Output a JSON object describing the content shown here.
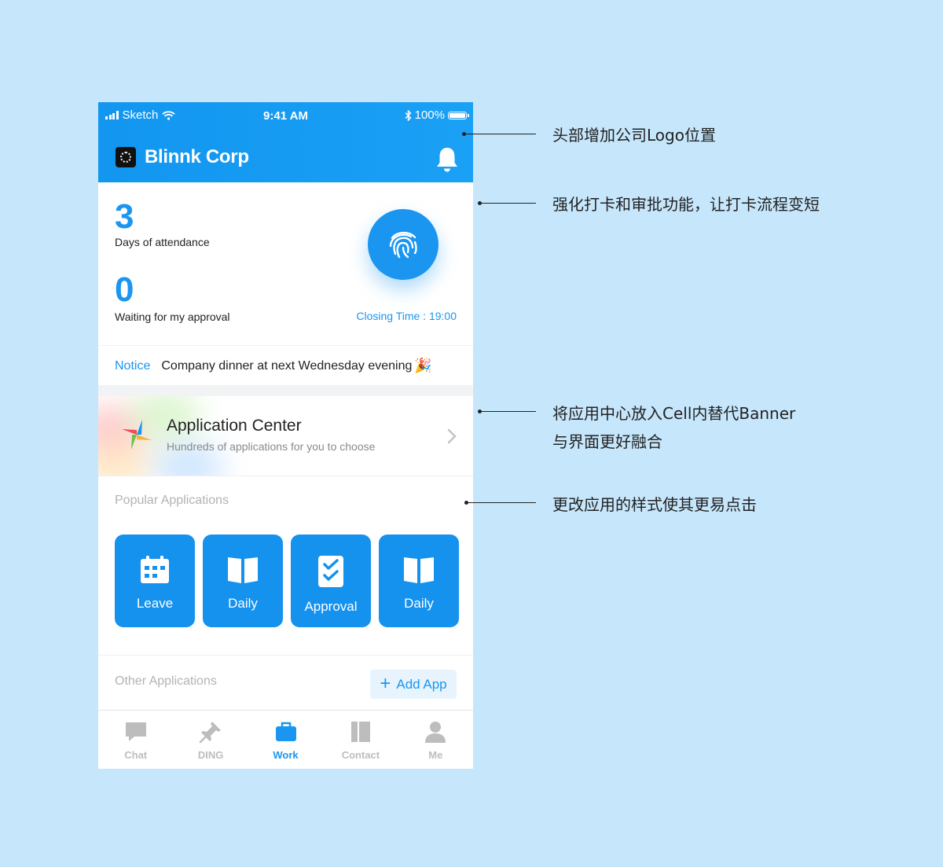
{
  "status_bar": {
    "carrier": "Sketch",
    "time": "9:41 AM",
    "battery": "100%"
  },
  "header": {
    "company": "Blinnk Corp",
    "logo_icon": "company-logo",
    "bell_icon": "bell-icon"
  },
  "attendance": {
    "days_count": "3",
    "days_label": "Days of attendance",
    "approval_count": "0",
    "approval_label": "Waiting for my approval",
    "fingerprint_icon": "fingerprint-icon",
    "closing_time": "Closing Time : 19:00"
  },
  "notice": {
    "tag": "Notice",
    "message": "Company dinner at next Wednesday evening",
    "emoji": "🎉"
  },
  "app_center": {
    "title": "Application Center",
    "subtitle": "Hundreds of applications for you to choose"
  },
  "popular": {
    "title": "Popular Applications",
    "apps": [
      {
        "label": "Leave",
        "icon": "calendar-icon"
      },
      {
        "label": "Daily",
        "icon": "book-icon"
      },
      {
        "label": "Approval",
        "icon": "checklist-icon"
      },
      {
        "label": "Daily",
        "icon": "book-icon"
      }
    ]
  },
  "other": {
    "title": "Other Applications",
    "add_label": "Add App"
  },
  "tabs": [
    {
      "label": "Chat",
      "icon": "chat-icon",
      "active": false
    },
    {
      "label": "DING",
      "icon": "pin-icon",
      "active": false
    },
    {
      "label": "Work",
      "icon": "briefcase-icon",
      "active": true
    },
    {
      "label": "Contact",
      "icon": "contact-book-icon",
      "active": false
    },
    {
      "label": "Me",
      "icon": "person-icon",
      "active": false
    }
  ],
  "annotations": [
    "头部增加公司Logo位置",
    "强化打卡和审批功能，让打卡流程变短",
    "将应用中心放入Cell内替代Banner",
    "与界面更好融合",
    "更改应用的样式使其更易点击"
  ],
  "colors": {
    "background": "#c6e6fb",
    "primary": "#1a96f0",
    "muted": "#b3b3b3"
  }
}
